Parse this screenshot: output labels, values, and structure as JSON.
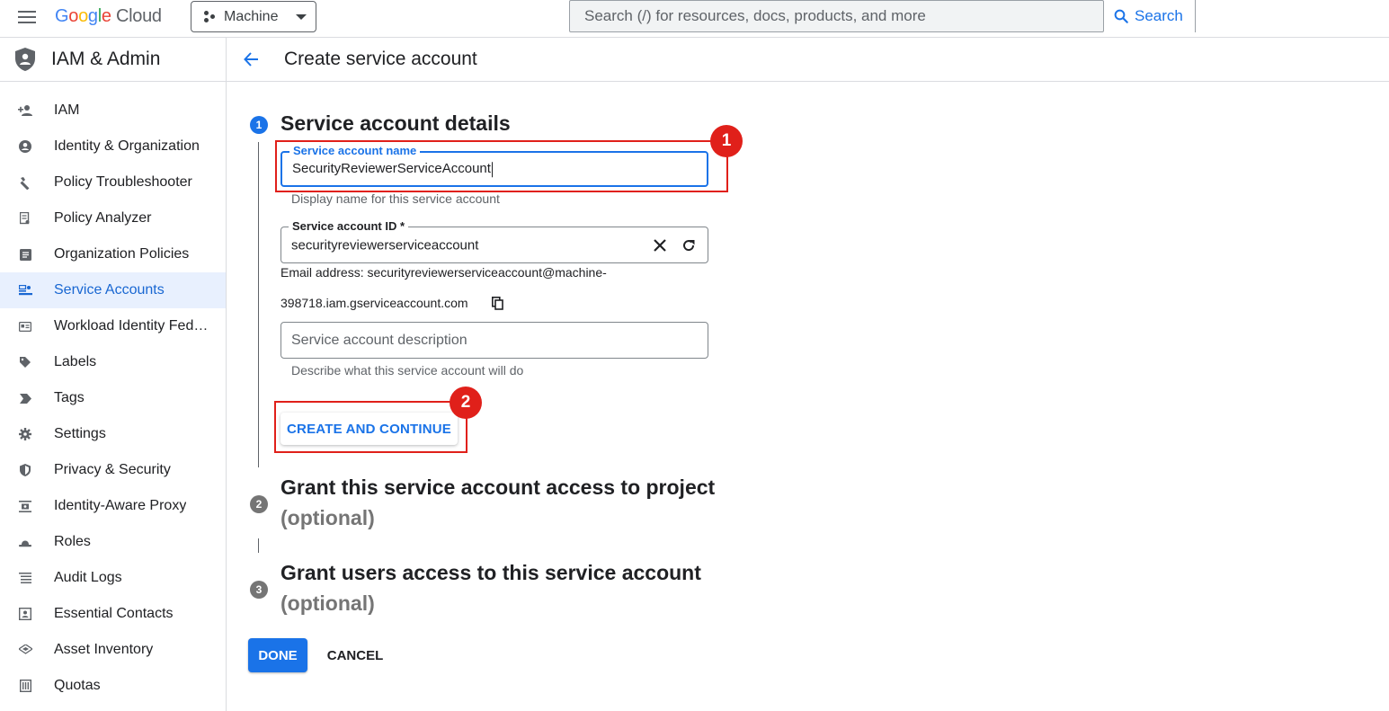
{
  "app": {
    "logo": {
      "google": "Google",
      "cloud": "Cloud"
    },
    "project_picker": {
      "label": "Machine"
    },
    "search": {
      "placeholder": "Search (/) for resources, docs, products, and more",
      "button_label": "Search"
    }
  },
  "sidebar": {
    "title": "IAM & Admin",
    "items": [
      {
        "label": "IAM",
        "icon": "person-add-icon"
      },
      {
        "label": "Identity & Organization",
        "icon": "account-circle-icon"
      },
      {
        "label": "Policy Troubleshooter",
        "icon": "wrench-icon"
      },
      {
        "label": "Policy Analyzer",
        "icon": "document-search-icon"
      },
      {
        "label": "Organization Policies",
        "icon": "list-doc-icon"
      },
      {
        "label": "Service Accounts",
        "icon": "service-account-icon",
        "active": true
      },
      {
        "label": "Workload Identity Feder…",
        "icon": "id-card-icon"
      },
      {
        "label": "Labels",
        "icon": "label-icon"
      },
      {
        "label": "Tags",
        "icon": "tag-icon"
      },
      {
        "label": "Settings",
        "icon": "gear-icon"
      },
      {
        "label": "Privacy & Security",
        "icon": "shield-icon"
      },
      {
        "label": "Identity-Aware Proxy",
        "icon": "proxy-icon"
      },
      {
        "label": "Roles",
        "icon": "roles-hat-icon"
      },
      {
        "label": "Audit Logs",
        "icon": "list-lines-icon"
      },
      {
        "label": "Essential Contacts",
        "icon": "contact-card-icon"
      },
      {
        "label": "Asset Inventory",
        "icon": "layers-icon"
      },
      {
        "label": "Quotas",
        "icon": "quota-icon"
      }
    ]
  },
  "page": {
    "title": "Create service account"
  },
  "steps": [
    {
      "number": "1",
      "title": "Service account details"
    },
    {
      "number": "2",
      "title": "Grant this service account access to project",
      "subtitle": "(optional)"
    },
    {
      "number": "3",
      "title": "Grant users access to this service account",
      "subtitle": "(optional)"
    }
  ],
  "form": {
    "name": {
      "label": "Service account name",
      "value": "SecurityReviewerServiceAccount",
      "hint": "Display name for this service account"
    },
    "id": {
      "label": "Service account ID *",
      "value": "securityreviewerserviceaccount"
    },
    "email": {
      "line1": "Email address: securityreviewerserviceaccount@machine-",
      "line2": "398718.iam.gserviceaccount.com"
    },
    "description": {
      "placeholder": "Service account description",
      "hint": "Describe what this service account will do"
    },
    "create_button": "CREATE AND CONTINUE"
  },
  "actions": {
    "done": "DONE",
    "cancel": "CANCEL"
  },
  "annotations": [
    {
      "label": "1"
    },
    {
      "label": "2"
    }
  ],
  "colors": {
    "accent": "#1a73e8",
    "annotation": "#e0201a",
    "active_bg": "#e8f0fe"
  }
}
